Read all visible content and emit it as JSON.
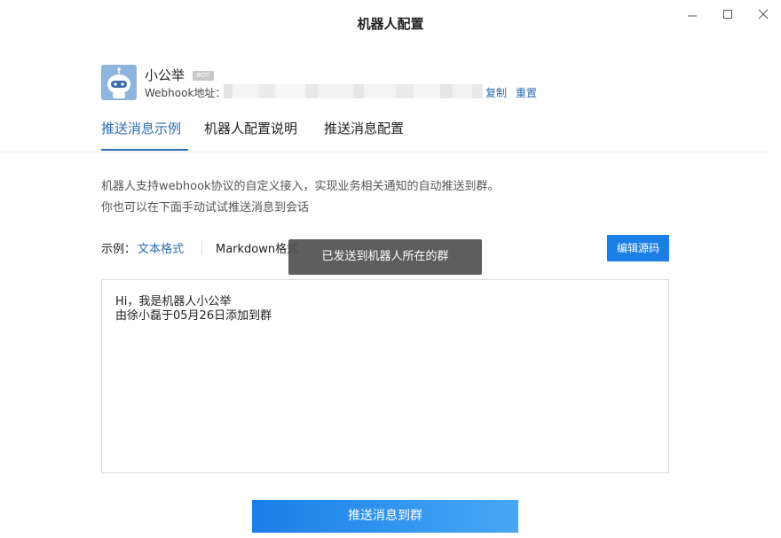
{
  "window": {
    "title": "机器人配置"
  },
  "bot": {
    "name": "小公举",
    "badge": "BOT",
    "webhook_label": "Webhook地址：",
    "copy_link": "复制",
    "reset_link": "重置"
  },
  "tabs": [
    {
      "label": "推送消息示例",
      "active": true
    },
    {
      "label": "机器人配置说明",
      "active": false
    },
    {
      "label": "推送消息配置",
      "active": false
    }
  ],
  "description": {
    "line1": "机器人支持webhook协议的自定义接入，实现业务相关通知的自动推送到群。",
    "line2": "你也可以在下面手动试试推送消息到会话"
  },
  "example": {
    "label": "示例：",
    "text_format": "文本格式",
    "markdown_format": "Markdown格式",
    "edit_source": "编辑源码"
  },
  "toast": {
    "message": "已发送到机器人所在的群"
  },
  "editor": {
    "line1": "Hi，我是机器人小公举",
    "line2": "由徐小磊于05月26日添加到群"
  },
  "send_button": "推送消息到群",
  "colors": {
    "accent": "#2b6cb0",
    "primary_button": "#1c7fe6",
    "toast_bg": "#505050"
  }
}
